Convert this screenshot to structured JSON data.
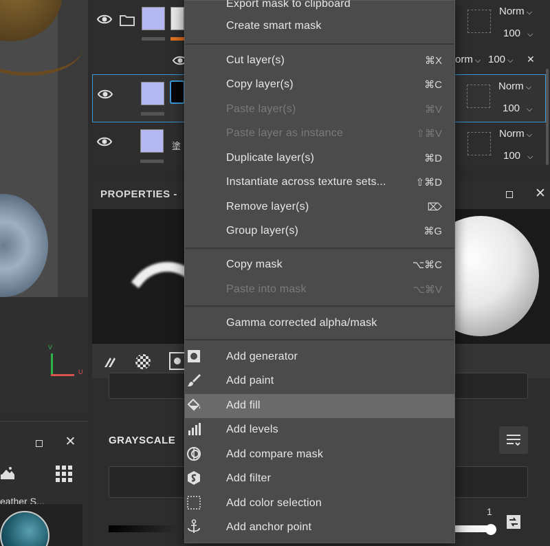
{
  "menu": {
    "items": [
      {
        "label": "Export mask to clipboard",
        "shortcut": "",
        "disabled": false
      },
      {
        "label": "Create smart mask",
        "shortcut": "",
        "disabled": false
      },
      {
        "label": "Cut layer(s)",
        "shortcut": "⌘X",
        "disabled": false
      },
      {
        "label": "Copy layer(s)",
        "shortcut": "⌘C",
        "disabled": false
      },
      {
        "label": "Paste layer(s)",
        "shortcut": "⌘V",
        "disabled": true
      },
      {
        "label": "Paste layer as instance",
        "shortcut": "⇧⌘V",
        "disabled": true
      },
      {
        "label": "Duplicate layer(s)",
        "shortcut": "⌘D",
        "disabled": false
      },
      {
        "label": "Instantiate across texture sets...",
        "shortcut": "⇧⌘D",
        "disabled": false
      },
      {
        "label": "Remove layer(s)",
        "shortcut": "⌦",
        "disabled": false
      },
      {
        "label": "Group layer(s)",
        "shortcut": "⌘G",
        "disabled": false
      },
      {
        "label": "Copy mask",
        "shortcut": "⌥⌘C",
        "disabled": false
      },
      {
        "label": "Paste into mask",
        "shortcut": "⌥⌘V",
        "disabled": true
      },
      {
        "label": "Gamma corrected alpha/mask",
        "shortcut": "",
        "disabled": false
      },
      {
        "label": "Add generator",
        "icon": "generator-icon"
      },
      {
        "label": "Add paint",
        "icon": "paint-brush-icon"
      },
      {
        "label": "Add fill",
        "icon": "fill-bucket-icon",
        "highlighted": true
      },
      {
        "label": "Add levels",
        "icon": "levels-icon"
      },
      {
        "label": "Add compare mask",
        "icon": "compare-mask-icon"
      },
      {
        "label": "Add filter",
        "icon": "filter-icon"
      },
      {
        "label": "Add color selection",
        "icon": "color-selection-icon"
      },
      {
        "label": "Add anchor point",
        "icon": "anchor-icon"
      }
    ]
  },
  "layers": {
    "rows": [
      {
        "blend": "Norm",
        "opacity": "100"
      },
      {
        "blend": "orm",
        "opacity": "100"
      },
      {
        "blend": "Norm",
        "opacity": "100"
      },
      {
        "blend": "Norm",
        "opacity": "100"
      }
    ],
    "layer_glyph": "塗"
  },
  "properties": {
    "title": "PROPERTIES -",
    "section_grayscale": "GRAYSCALE",
    "slider_value": "1"
  },
  "left_panel": {
    "thumb_label": "eather S..."
  },
  "gizmo": {
    "v": "V",
    "u": "U"
  },
  "colors": {
    "accent": "#3a9ad9",
    "menu_bg": "#4b4b4b",
    "highlight": "#6a6a6a",
    "orange": "#e07020"
  }
}
